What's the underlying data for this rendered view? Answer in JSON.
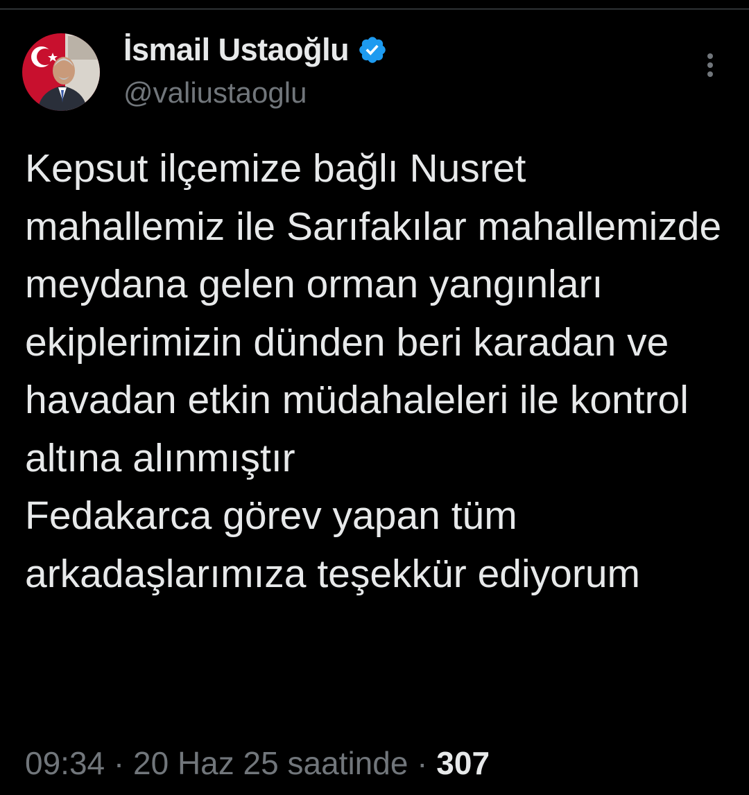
{
  "author": {
    "display_name": "İsmail Ustaoğlu",
    "handle": "@valiustaoglu",
    "verified_badge": "verified-badge-icon",
    "badge_color": "#1d9bf0"
  },
  "tweet": {
    "text": "Kepsut ilçemize bağlı Nusret mahallemiz ile Sarıfakılar mahallemizde meydana gelen orman yangınları ekiplerimizin dünden beri karadan ve havadan etkin müdahaleleri ile kontrol altına alınmıştır\nFedakarca görev yapan tüm arkadaşlarımıza teşekkür ediyorum",
    "time": "09:34",
    "separator_1": " · ",
    "date": "20 Haz 25 saatinde",
    "separator_2": " · ",
    "views": "307"
  },
  "icons": {
    "more": "more-vertical-icon",
    "avatar": "avatar"
  },
  "colors": {
    "background": "#000000",
    "text_primary": "#e7e9ea",
    "text_secondary": "#71767b",
    "divider": "#2f3336"
  }
}
